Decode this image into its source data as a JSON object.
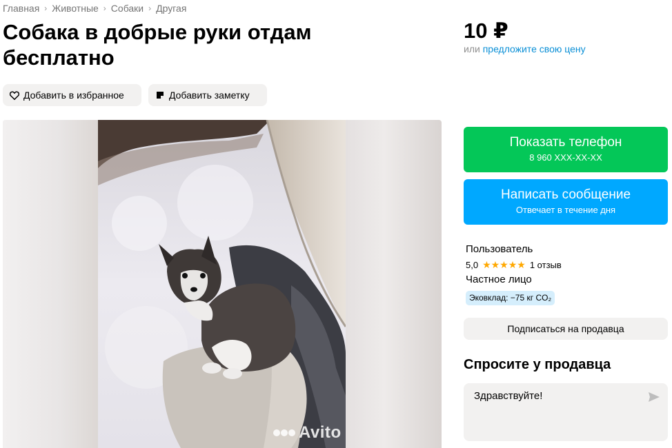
{
  "breadcrumb": [
    "Главная",
    "Животные",
    "Собаки",
    "Другая"
  ],
  "breadcrumb_separator": "›",
  "title": "Собака в добрые руки отдам бесплатно",
  "actions": {
    "favorite_label": "Добавить в избранное",
    "note_label": "Добавить заметку",
    "favorite_icon": "heart-icon",
    "note_icon": "note-icon"
  },
  "price": {
    "value": "10 ₽",
    "alt_prefix": "или",
    "alt_link": "предложите свою цену"
  },
  "gallery": {
    "watermark": "Avito",
    "photo_subject": "dog"
  },
  "contact": {
    "phone_label": "Показать телефон",
    "phone_masked": "8 960 XXX-XX-XX",
    "message_label": "Написать сообщение",
    "message_sub": "Отвечает в течение дня"
  },
  "seller": {
    "name": "Пользователь",
    "rating": "5,0",
    "stars": "★★★★★",
    "reviews": "1 отзыв",
    "type": "Частное лицо",
    "eco_badge": "Эковклад: −75 кг CO₂",
    "subscribe_label": "Подписаться на продавца"
  },
  "ask": {
    "title": "Спросите у продавца",
    "message_value": "Здравствуйте!",
    "send_icon": "send-icon"
  },
  "colors": {
    "green": "#04c758",
    "blue": "#00a8ff",
    "link": "#0a8fd6",
    "star": "#ffa800",
    "pill_bg": "#f2f1f0",
    "eco_bg": "#d5eefc"
  }
}
